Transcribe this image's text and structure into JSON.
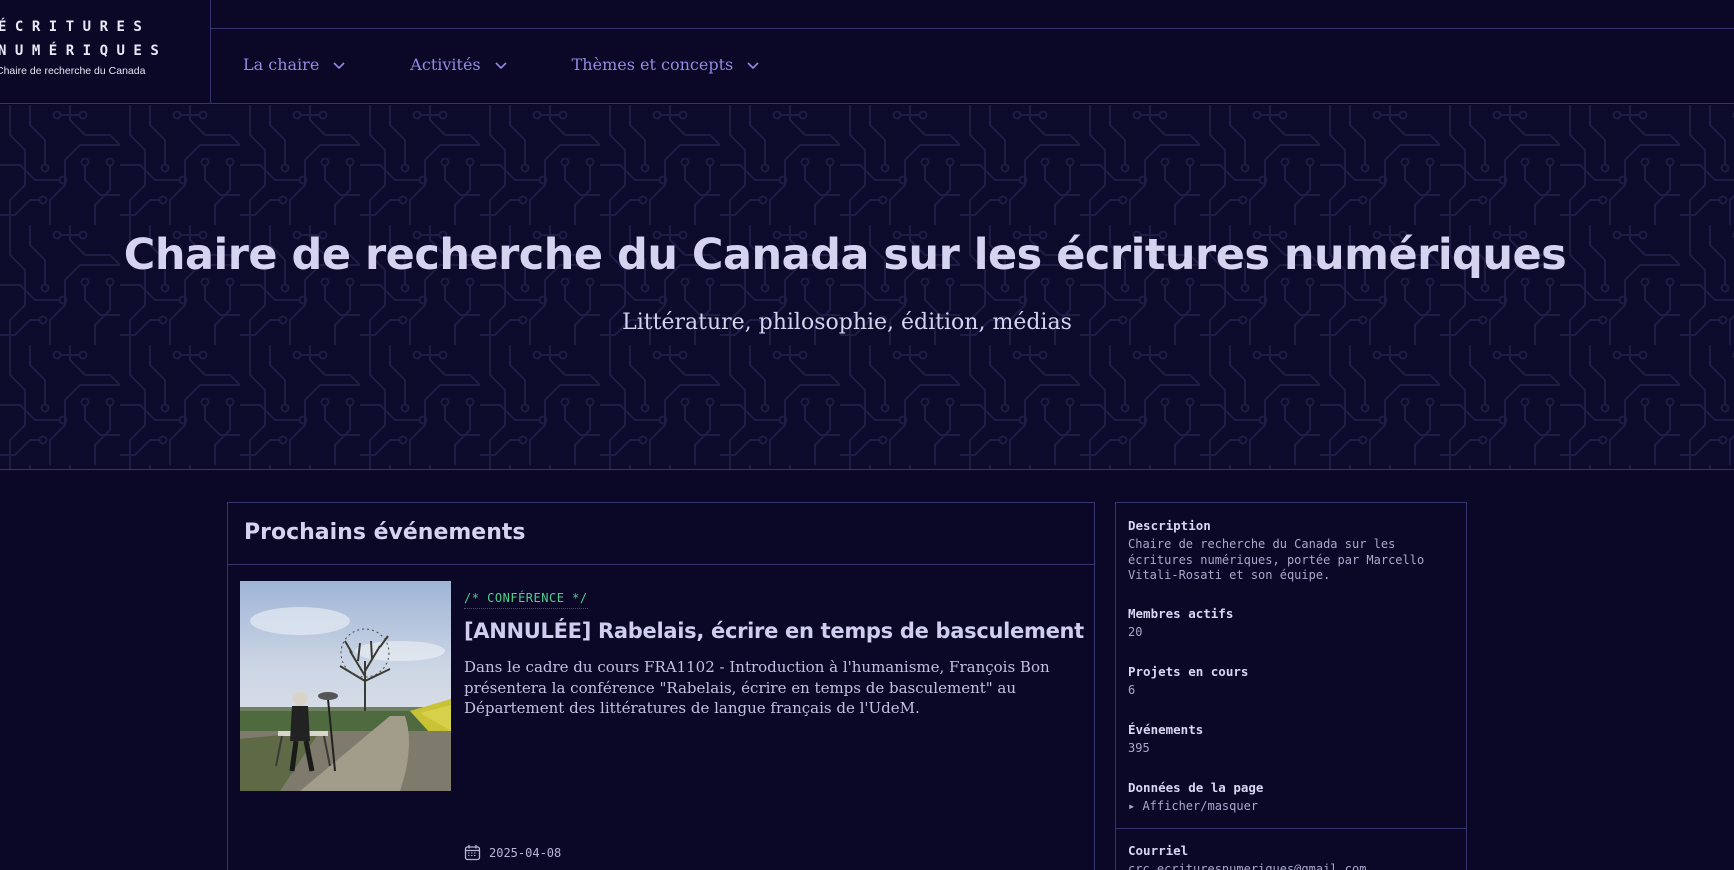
{
  "logo": {
    "line1": "ÉCRITURES",
    "line2": "NUMÉRIQUES",
    "subtitle": "Chaire de recherche du Canada"
  },
  "nav": {
    "items": [
      {
        "label": "La chaire"
      },
      {
        "label": "Activités"
      },
      {
        "label": "Thèmes et concepts"
      }
    ]
  },
  "hero": {
    "title": "Chaire de recherche du Canada sur les écritures numériques",
    "subtitle": "Littérature, philosophie, édition, médias"
  },
  "events": {
    "heading": "Prochains événements",
    "items": [
      {
        "tag": "/* CONFÉRENCE */",
        "title": "[ANNULÉE] Rabelais, écrire en temps de basculement",
        "description": "Dans le cadre du cours FRA1102 - Introduction à l'humanisme, François Bon présentera la conférence \"Rabelais, écrire en temps de basculement\" au Département des littératures de langue français de l'UdeM.",
        "date": "2025-04-08",
        "icon": "calendar-icon"
      }
    ]
  },
  "sidebar": {
    "description_label": "Description",
    "description_value": "Chaire de recherche du Canada sur les écritures numériques, portée par Marcello Vitali-Rosati et son équipe.",
    "members_label": "Membres actifs",
    "members_value": "20",
    "projects_label": "Projets en cours",
    "projects_value": "6",
    "events_label": "Événements",
    "events_value": "395",
    "pagedata_label": "Données de la page",
    "pagedata_toggle": "Afficher/masquer",
    "email_label": "Courriel",
    "email_value": "crc.ecrituresnumeriques@gmail.com"
  },
  "colors": {
    "background": "#0a0826",
    "border": "#35356e",
    "nav_link": "#8f8ce2",
    "tag_green": "#4fd08a"
  }
}
